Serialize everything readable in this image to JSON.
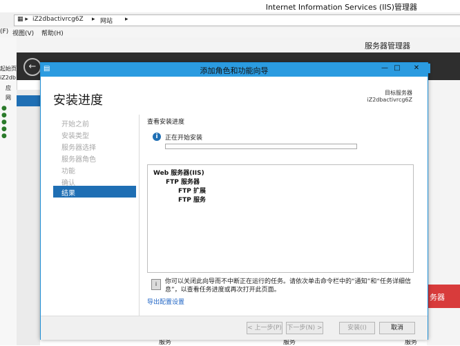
{
  "iis": {
    "window_title": "Internet Information Services (IIS)管理器",
    "breadcrumb": [
      "iZ2dbactivrcg6Z",
      "网站"
    ],
    "menu": [
      "(F)",
      "视图(V)",
      "帮助(H)"
    ],
    "left_tree_labels": [
      "起始页",
      "iZ2db",
      "应",
      "网"
    ]
  },
  "server_manager": {
    "title": "服务器管理器",
    "red_tile_label": "务器",
    "bottom_labels": [
      "服务",
      "服务",
      "服务"
    ]
  },
  "wizard": {
    "title": "添加角色和功能向导",
    "heading": "安装进度",
    "target_label": "目标服务器",
    "target_name": "iZ2dbactivrcg6Z",
    "titlebar_buttons": [
      "—",
      "□",
      "✕"
    ],
    "nav": [
      "开始之前",
      "安装类型",
      "服务器选择",
      "服务器角色",
      "功能",
      "确认",
      "结果"
    ],
    "view_progress": "查看安装进度",
    "status": "正在开始安装",
    "progress": 0,
    "features": [
      {
        "label": "Web 服务器(IIS)",
        "level": 0
      },
      {
        "label": "FTP 服务器",
        "level": 1
      },
      {
        "label": "FTP 扩展",
        "level": 2
      },
      {
        "label": "FTP 服务",
        "level": 2
      }
    ],
    "note": "你可以关闭此向导而不中断正在运行的任务。请依次单击命令栏中的“通知”和“任务详细信息”，以查看任务进度或再次打开此页面。",
    "export": "导出配置设置",
    "buttons": {
      "prev": "< 上一步(P)",
      "next": "下一步(N) >",
      "install": "安装(I)",
      "cancel": "取消"
    }
  }
}
